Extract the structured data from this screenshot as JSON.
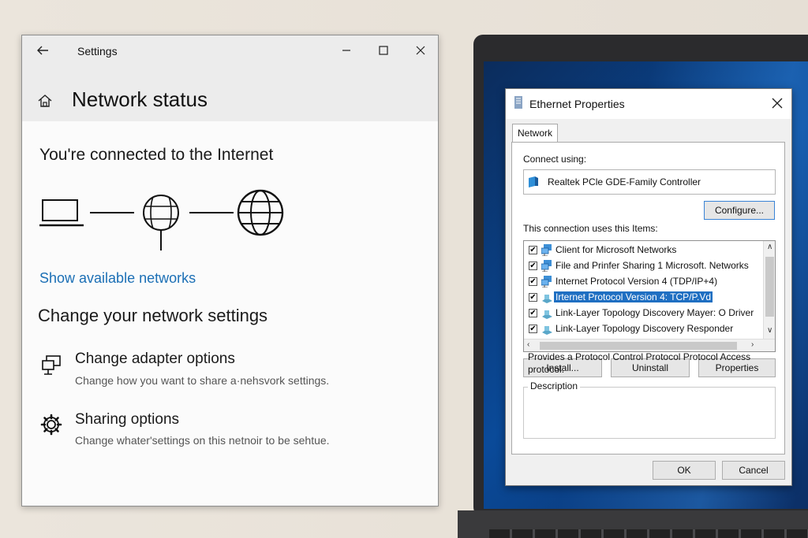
{
  "settings": {
    "window_title": "Settings",
    "page_title": "Network status",
    "connected_heading": "You're connected to the Internet",
    "show_networks_link": "Show available networks",
    "change_heading": "Change your network settings",
    "options": [
      {
        "title": "Change adapter options",
        "desc": "Change how you want to share a·nehsvork settings.",
        "icon": "adapter-icon"
      },
      {
        "title": "Sharing options",
        "desc": "Change whater'settings on this netnoir to be sehtue.",
        "icon": "gear-icon"
      }
    ]
  },
  "dialog": {
    "title": "Ethernet Properties",
    "tab": "Network",
    "connect_using_label": "Connect using:",
    "adapter_name": "Realtek PCle GDE-Family Controller",
    "configure_button": "Configure...",
    "items_label": "This connection uses this Items:",
    "items": [
      {
        "label": "Client for Microsoft Networks",
        "checked": true,
        "selected": false
      },
      {
        "label": "File and Prinfer Sharing 1 Microsoft. Networks",
        "checked": true,
        "selected": false
      },
      {
        "label": "Internet Protocol Version 4 (TDP/IP+4)",
        "checked": true,
        "selected": false
      },
      {
        "label": "Irternet Protocol Version 4: TCP/P.Vd",
        "checked": true,
        "selected": true
      },
      {
        "label": "Link-Layer Topology Discovery Mayer: O Driver",
        "checked": true,
        "selected": false
      },
      {
        "label": "Link-Layer Topology Discovery Responder",
        "checked": true,
        "selected": false
      }
    ],
    "install_button": "Install...",
    "uninstall_button": "Uninstall",
    "properties_button": "Properties",
    "description_label": "Description",
    "description_text": "Provides a Protocol Control Protocol Protocol Access protocol.",
    "ok_button": "OK",
    "cancel_button": "Cancel"
  },
  "colors": {
    "link": "#1b6fb5",
    "selection": "#1f6fc2",
    "desktop": "#0a4a99"
  }
}
